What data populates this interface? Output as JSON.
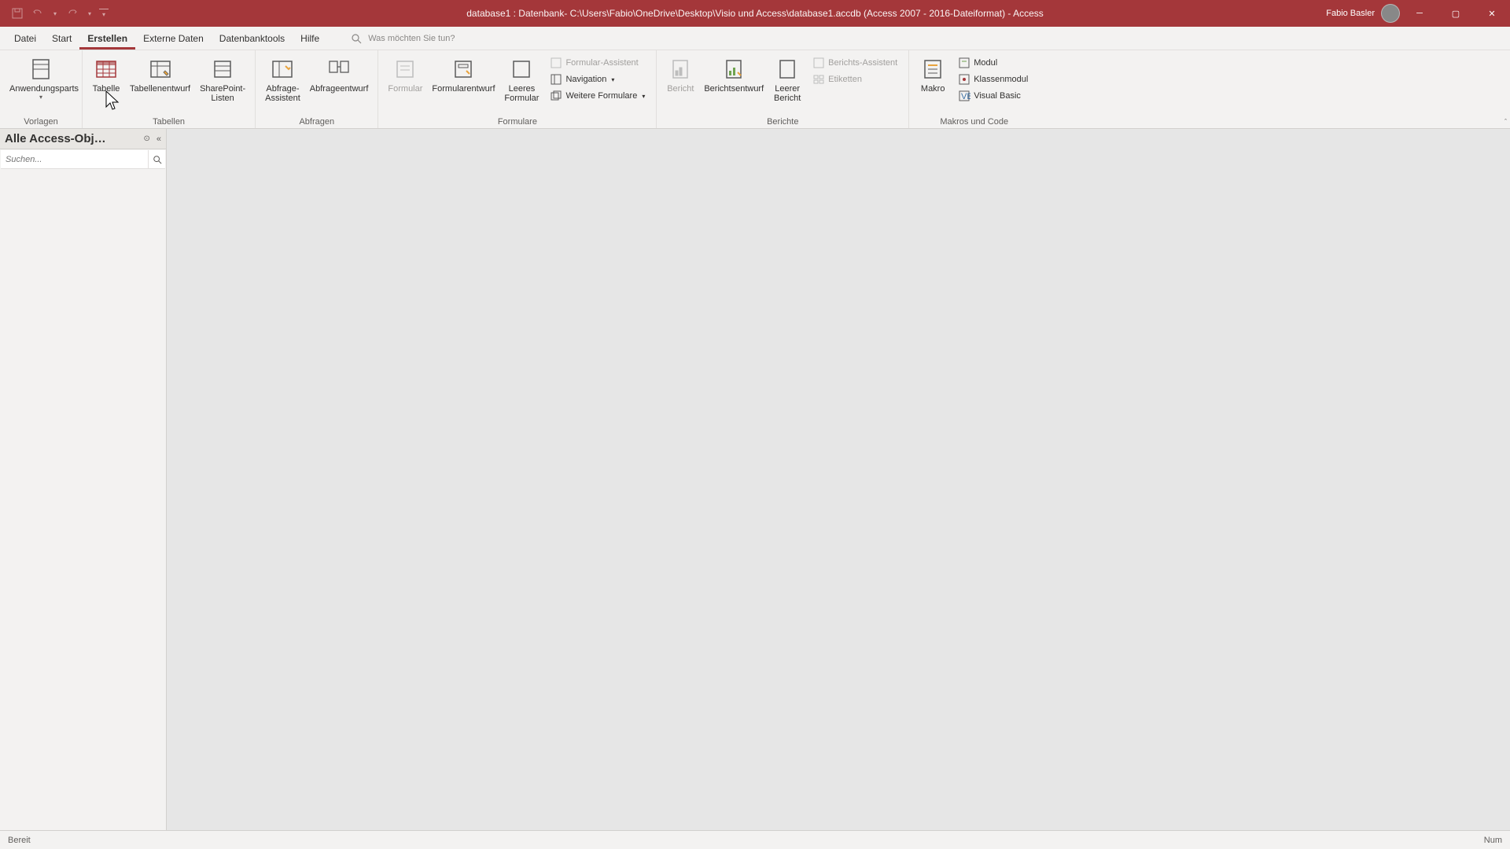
{
  "titlebar": {
    "title": "database1 : Datenbank- C:\\Users\\Fabio\\OneDrive\\Desktop\\Visio und Access\\database1.accdb (Access 2007 - 2016-Dateiformat)  -  Access",
    "user": "Fabio Basler"
  },
  "tabs": {
    "items": [
      "Datei",
      "Start",
      "Erstellen",
      "Externe Daten",
      "Datenbanktools",
      "Hilfe"
    ],
    "active_index": 2,
    "tell_me_placeholder": "Was möchten Sie tun?"
  },
  "ribbon": {
    "groups": {
      "vorlagen": {
        "label": "Vorlagen",
        "app_parts": "Anwendungsparts"
      },
      "tabellen": {
        "label": "Tabellen",
        "tabelle": "Tabelle",
        "entwurf": "Tabellenentwurf",
        "sharepoint": "SharePoint-\nListen"
      },
      "abfragen": {
        "label": "Abfragen",
        "assistent": "Abfrage-\nAssistent",
        "entwurf": "Abfrageentwurf"
      },
      "formulare": {
        "label": "Formulare",
        "formular": "Formular",
        "entwurf": "Formularentwurf",
        "leer": "Leeres\nFormular",
        "assist": "Formular-Assistent",
        "nav": "Navigation",
        "weitere": "Weitere Formulare"
      },
      "berichte": {
        "label": "Berichte",
        "bericht": "Bericht",
        "entwurf": "Berichtsentwurf",
        "leer": "Leerer\nBericht",
        "assist": "Berichts-Assistent",
        "etik": "Etiketten"
      },
      "makros": {
        "label": "Makros und Code",
        "makro": "Makro",
        "modul": "Modul",
        "klasse": "Klassenmodul",
        "vb": "Visual Basic"
      }
    }
  },
  "navpane": {
    "title": "Alle Access-Obj…",
    "search_placeholder": "Suchen..."
  },
  "statusbar": {
    "left": "Bereit",
    "right": "Num"
  }
}
